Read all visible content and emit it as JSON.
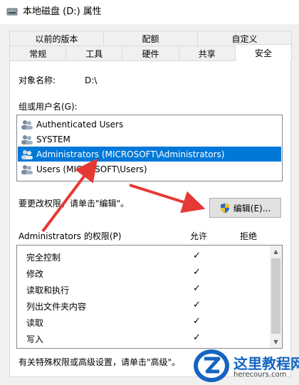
{
  "window": {
    "title": "本地磁盘 (D:) 属性",
    "icon": "drive-icon"
  },
  "tabs": {
    "back_row": [
      "以前的版本",
      "配额",
      "自定义"
    ],
    "front_row": [
      "常规",
      "工具",
      "硬件",
      "共享",
      "安全"
    ],
    "selected": "安全"
  },
  "security": {
    "object_name_label": "对象名称:",
    "object_name_value": "D:\\",
    "group_label": "组或用户名(G):",
    "users": [
      "Authenticated Users",
      "SYSTEM",
      "Administrators (MICROSOFT\\Administrators)",
      "Users (MICROSOFT\\Users)"
    ],
    "selected_user_index": 2,
    "change_hint": "要更改权限，请单击\"编辑\"。",
    "edit_button": "编辑(E)...",
    "permissions_label": "Administrators 的权限(P)",
    "allow_header": "允许",
    "deny_header": "拒绝",
    "permissions": [
      {
        "name": "完全控制",
        "allow": "✓"
      },
      {
        "name": "修改",
        "allow": "✓"
      },
      {
        "name": "读取和执行",
        "allow": "✓"
      },
      {
        "name": "列出文件夹内容",
        "allow": "✓"
      },
      {
        "name": "读取",
        "allow": "✓"
      },
      {
        "name": "写入",
        "allow": "✓"
      }
    ],
    "advanced_hint": "有关特殊权限或高级设置，请单击\"高级\"。"
  },
  "watermark": {
    "title": "这里教程网",
    "url": "herecours.com"
  },
  "colors": {
    "selection": "#0078d7",
    "annotation_arrow": "#e53935",
    "watermark_blue": "#1565c0"
  }
}
